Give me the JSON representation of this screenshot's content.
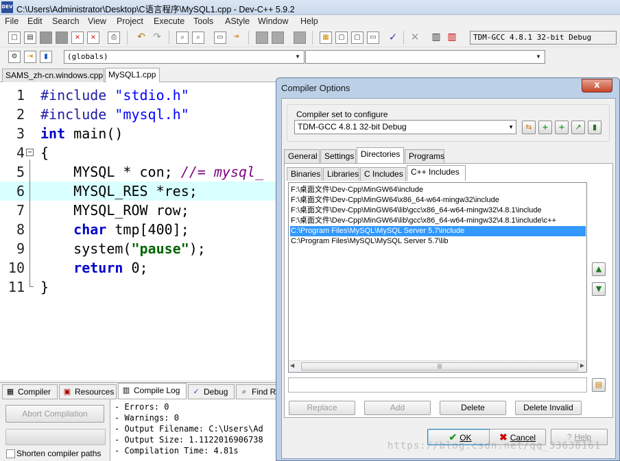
{
  "window": {
    "title": "C:\\Users\\Administrator\\Desktop\\C语言程序\\MySQL1.cpp - Dev-C++ 5.9.2",
    "app_icon_text": "DEV"
  },
  "menu": [
    "File",
    "Edit",
    "Search",
    "View",
    "Project",
    "Execute",
    "Tools",
    "AStyle",
    "Window",
    "Help"
  ],
  "toolbar": {
    "compiler_select": "TDM-GCC 4.8.1 32-bit Debug",
    "scope_select": "(globals)",
    "symbol_select": ""
  },
  "editor_tabs": [
    "SAMS_zh-cn.windows.cpp",
    "MySQL1.cpp"
  ],
  "code": [
    {
      "n": "1",
      "text": "#include \"stdio.h\""
    },
    {
      "n": "2",
      "text": "#include \"mysql.h\""
    },
    {
      "n": "3",
      "text": "int main()"
    },
    {
      "n": "4",
      "text": "{"
    },
    {
      "n": "5",
      "text": "    MYSQL * con; //= mysql_"
    },
    {
      "n": "6",
      "text": "    MYSQL_RES *res;"
    },
    {
      "n": "7",
      "text": "    MYSQL_ROW row;"
    },
    {
      "n": "8",
      "text": "    char tmp[400];"
    },
    {
      "n": "9",
      "text": "    system(\"pause\");"
    },
    {
      "n": "10",
      "text": "    return 0;"
    },
    {
      "n": "11",
      "text": "}"
    }
  ],
  "bottom_tabs": [
    "Compiler",
    "Resources",
    "Compile Log",
    "Debug",
    "Find R"
  ],
  "bottom_tab_icons": [
    "grid-icon",
    "resources-icon",
    "chart-icon",
    "check-icon",
    "find-icon"
  ],
  "compile": {
    "abort_label": "Abort Compilation",
    "shorten_label": "Shorten compiler paths",
    "log": [
      "- Errors: 0",
      "- Warnings: 0",
      "- Output Filename: C:\\Users\\Ad",
      "- Output Size: 1.1122016906738",
      "- Compilation Time: 4.81s"
    ]
  },
  "dialog": {
    "title": "Compiler Options",
    "close": "x",
    "set_label": "Compiler set to configure",
    "set_value": "TDM-GCC 4.8.1 32-bit Debug",
    "tabs": [
      "General",
      "Settings",
      "Directories",
      "Programs"
    ],
    "subtabs": [
      "Binaries",
      "Libraries",
      "C Includes",
      "C++ Includes"
    ],
    "paths": [
      "F:\\桌面文件\\Dev-Cpp\\MinGW64\\include",
      "F:\\桌面文件\\Dev-Cpp\\MinGW64\\x86_64-w64-mingw32\\include",
      "F:\\桌面文件\\Dev-Cpp\\MinGW64\\lib\\gcc\\x86_64-w64-mingw32\\4.8.1\\include",
      "F:\\桌面文件\\Dev-Cpp\\MinGW64\\lib\\gcc\\x86_64-w64-mingw32\\4.8.1\\include\\c++",
      "C:\\Program Files\\MySQL\\MySQL Server 5.7\\include",
      "C:\\Program Files\\MySQL\\MySQL Server 5.7\\lib"
    ],
    "selected_path_index": 4,
    "path_input": "",
    "buttons": {
      "replace": "Replace",
      "add": "Add",
      "delete": "Delete",
      "delete_invalid": "Delete Invalid"
    },
    "ok": "OK",
    "cancel": "Cancel",
    "help": "Help"
  },
  "watermark": "https://blog.csdn.net/qq_33638161"
}
